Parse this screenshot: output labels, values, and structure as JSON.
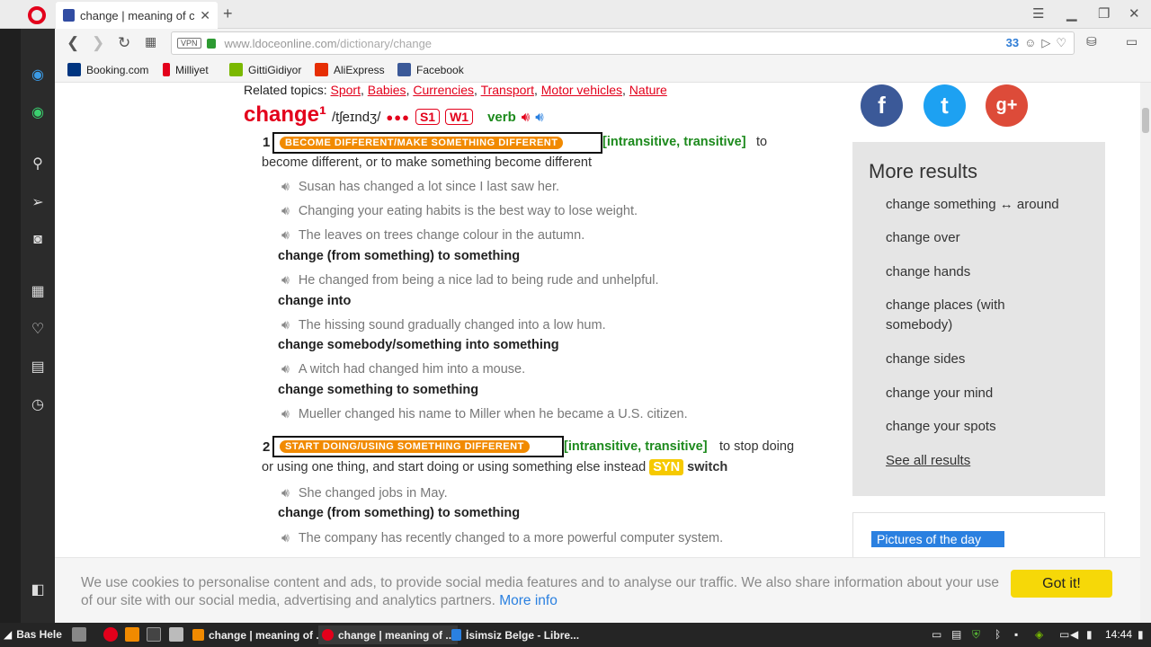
{
  "browser": {
    "tab_title": "change | meaning of cha",
    "tab_close": "✕",
    "new_tab": "+",
    "url_host": "www.ldoceonline.com",
    "url_path": "/dictionary/change",
    "vpn_label": "VPN",
    "ad_count": "33",
    "bookmarks": [
      {
        "label": "Booking.com",
        "color": "#003580"
      },
      {
        "label": "Milliyet",
        "color": "#e3001b"
      },
      {
        "label": "GittiGidiyor",
        "color": "#7ab800"
      },
      {
        "label": "AliExpress",
        "color": "#e62e04"
      },
      {
        "label": "Facebook",
        "color": "#3b5998"
      }
    ]
  },
  "entry": {
    "related_label": "Related topics:",
    "related_topics": [
      "Sport",
      "Babies",
      "Currencies",
      "Transport",
      "Motor vehicles",
      "Nature"
    ],
    "headword": "change¹",
    "pronunciation": "/tʃeɪndʒ/",
    "frequency_dots": "●●●",
    "level_s": "S1",
    "level_w": "W1",
    "pos": "verb",
    "senses": [
      {
        "num": "1",
        "signpost": "BECOME DIFFERENT/MAKE SOMETHING DIFFERENT",
        "grammar": "[intransitive, transitive]",
        "def_line1": "to",
        "def_line2": "become different, or to make something become different"
      },
      {
        "num": "2",
        "signpost": "START DOING/USING SOMETHING DIFFERENT",
        "grammar": "[intransitive, transitive]",
        "def_line1": "to stop doing",
        "def_line2": "or using one thing, and start doing or using something else instead",
        "syn_label": "SYN",
        "syn_word": "switch"
      }
    ],
    "examples": [
      "Susan has changed a lot since I last saw her.",
      "Changing your eating habits is the best way to lose weight.",
      "The leaves on trees change colour in the autumn.",
      "He changed from being a nice lad to being rude and unhelpful.",
      "The hissing sound gradually changed into a low hum.",
      "A witch had changed him into a mouse.",
      "Mueller changed his name to Miller when he became a U.S. citizen.",
      "She changed jobs in May.",
      "The company has recently changed to a more powerful computer system."
    ],
    "collocations": [
      "change (from something) to something",
      "change into",
      "change somebody/something into something",
      "change something to something",
      "change (from something) to something"
    ]
  },
  "more_results": {
    "title": "More results",
    "items": [
      "change something ↔ around",
      "change over",
      "change hands",
      "change places (with somebody)",
      "change sides",
      "change your mind",
      "change your spots"
    ],
    "see_all": "See all results"
  },
  "potd": "Pictures of the day",
  "social": {
    "facebook": "f",
    "twitter": "t",
    "google": "g+"
  },
  "cookie": {
    "text": "We use cookies to personalise content and ads, to provide social media features and to analyse our traffic. We also share information about your use of our site with our social media, advertising and analytics partners.",
    "more": "More info",
    "button": "Got it!"
  },
  "taskbar": {
    "start": "Bas Hele",
    "tasks": [
      "change | meaning of ...",
      "change | meaning of ...",
      "İsimsiz Belge - Libre..."
    ],
    "clock": "14:44"
  }
}
